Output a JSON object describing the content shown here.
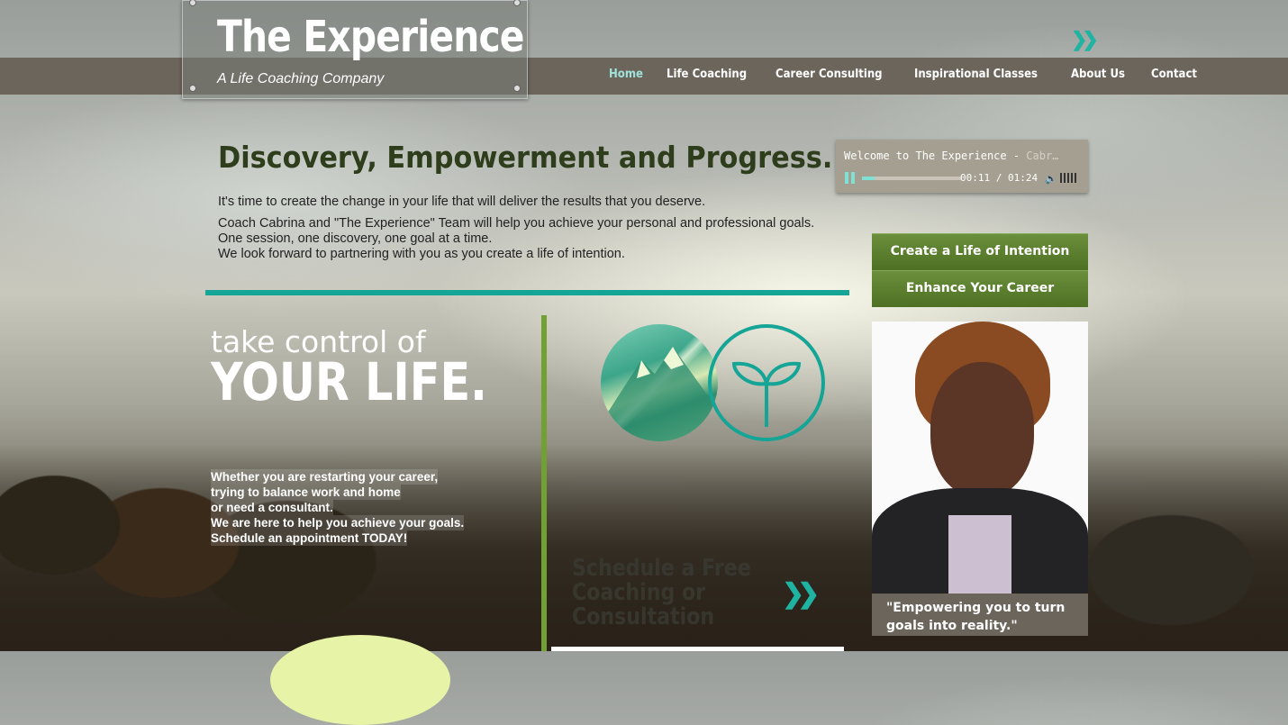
{
  "brand": {
    "title": "The Experience",
    "subtitle": "A Life Coaching Company"
  },
  "nav": {
    "items": [
      "Home",
      "Life Coaching",
      "Career Consulting",
      "Inspirational Classes",
      "About Us",
      "Contact"
    ],
    "active": "Home"
  },
  "main": {
    "headline": "Discovery, Empowerment and Progress.",
    "intro": [
      "It's time to create  the change in your life that will deliver the results that you deserve.",
      "Coach Cabrina and \"The Experience\" Team will help you achieve your personal and professional goals.",
      "One session, one discovery, one goal at a time.",
      "We look forward to partnering with you as you create a life of intention."
    ],
    "take_control_line1": "take control of",
    "take_control_line2": "YOUR LIFE.",
    "bullets": [
      "Whether you are restarting your career,",
      "trying to balance work and home",
      "or need a consultant.",
      "We are here to help you achieve your goals.",
      "Schedule an appointment TODAY!"
    ],
    "schedule_lines": [
      "Schedule a Free",
      "Coaching or",
      "Consultation"
    ]
  },
  "player": {
    "title": "Welcome to The Experience - ",
    "title_dim": "Cabr…",
    "time": "00:11 / 01:24",
    "progress": 0.13
  },
  "sidebar": {
    "buttons": [
      "Create a Life of Intention",
      "Enhance Your Career"
    ],
    "quote": "\"Empowering you to turn goals into reality.\""
  },
  "icons": {
    "nav_chevron": "double-chevron-right-icon",
    "schedule_chevron": "double-chevron-right-icon",
    "sprout": "sprout-icon",
    "mountain": "mountain-image"
  },
  "colors": {
    "teal": "#14a596",
    "green": "#71a133",
    "navbar": "#6c655b",
    "button_green": "#4d7023",
    "active_nav": "#9fe3db"
  }
}
